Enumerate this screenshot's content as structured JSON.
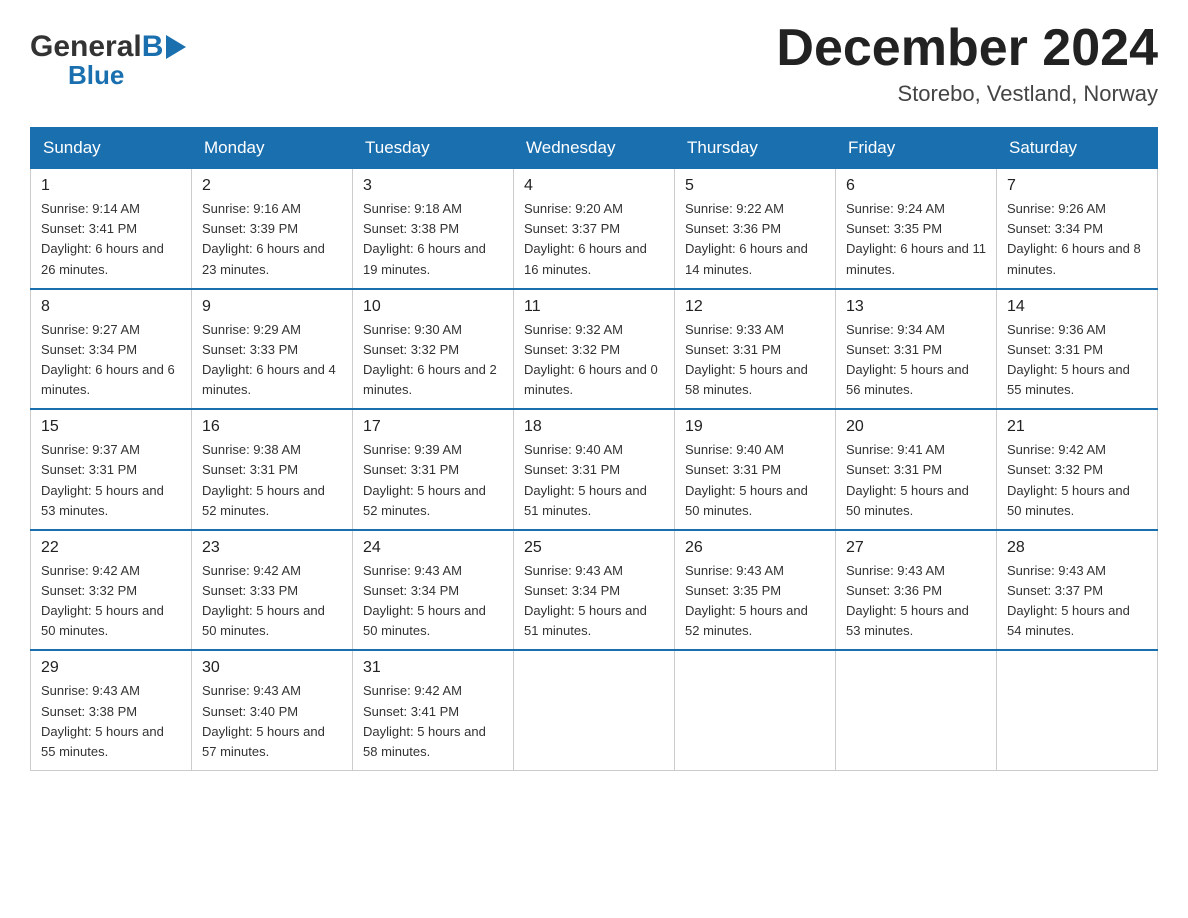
{
  "header": {
    "logo_general": "General",
    "logo_blue": "Blue",
    "month_title": "December 2024",
    "location": "Storebo, Vestland, Norway"
  },
  "days_of_week": [
    "Sunday",
    "Monday",
    "Tuesday",
    "Wednesday",
    "Thursday",
    "Friday",
    "Saturday"
  ],
  "weeks": [
    [
      {
        "day": "1",
        "sunrise": "Sunrise: 9:14 AM",
        "sunset": "Sunset: 3:41 PM",
        "daylight": "Daylight: 6 hours and 26 minutes."
      },
      {
        "day": "2",
        "sunrise": "Sunrise: 9:16 AM",
        "sunset": "Sunset: 3:39 PM",
        "daylight": "Daylight: 6 hours and 23 minutes."
      },
      {
        "day": "3",
        "sunrise": "Sunrise: 9:18 AM",
        "sunset": "Sunset: 3:38 PM",
        "daylight": "Daylight: 6 hours and 19 minutes."
      },
      {
        "day": "4",
        "sunrise": "Sunrise: 9:20 AM",
        "sunset": "Sunset: 3:37 PM",
        "daylight": "Daylight: 6 hours and 16 minutes."
      },
      {
        "day": "5",
        "sunrise": "Sunrise: 9:22 AM",
        "sunset": "Sunset: 3:36 PM",
        "daylight": "Daylight: 6 hours and 14 minutes."
      },
      {
        "day": "6",
        "sunrise": "Sunrise: 9:24 AM",
        "sunset": "Sunset: 3:35 PM",
        "daylight": "Daylight: 6 hours and 11 minutes."
      },
      {
        "day": "7",
        "sunrise": "Sunrise: 9:26 AM",
        "sunset": "Sunset: 3:34 PM",
        "daylight": "Daylight: 6 hours and 8 minutes."
      }
    ],
    [
      {
        "day": "8",
        "sunrise": "Sunrise: 9:27 AM",
        "sunset": "Sunset: 3:34 PM",
        "daylight": "Daylight: 6 hours and 6 minutes."
      },
      {
        "day": "9",
        "sunrise": "Sunrise: 9:29 AM",
        "sunset": "Sunset: 3:33 PM",
        "daylight": "Daylight: 6 hours and 4 minutes."
      },
      {
        "day": "10",
        "sunrise": "Sunrise: 9:30 AM",
        "sunset": "Sunset: 3:32 PM",
        "daylight": "Daylight: 6 hours and 2 minutes."
      },
      {
        "day": "11",
        "sunrise": "Sunrise: 9:32 AM",
        "sunset": "Sunset: 3:32 PM",
        "daylight": "Daylight: 6 hours and 0 minutes."
      },
      {
        "day": "12",
        "sunrise": "Sunrise: 9:33 AM",
        "sunset": "Sunset: 3:31 PM",
        "daylight": "Daylight: 5 hours and 58 minutes."
      },
      {
        "day": "13",
        "sunrise": "Sunrise: 9:34 AM",
        "sunset": "Sunset: 3:31 PM",
        "daylight": "Daylight: 5 hours and 56 minutes."
      },
      {
        "day": "14",
        "sunrise": "Sunrise: 9:36 AM",
        "sunset": "Sunset: 3:31 PM",
        "daylight": "Daylight: 5 hours and 55 minutes."
      }
    ],
    [
      {
        "day": "15",
        "sunrise": "Sunrise: 9:37 AM",
        "sunset": "Sunset: 3:31 PM",
        "daylight": "Daylight: 5 hours and 53 minutes."
      },
      {
        "day": "16",
        "sunrise": "Sunrise: 9:38 AM",
        "sunset": "Sunset: 3:31 PM",
        "daylight": "Daylight: 5 hours and 52 minutes."
      },
      {
        "day": "17",
        "sunrise": "Sunrise: 9:39 AM",
        "sunset": "Sunset: 3:31 PM",
        "daylight": "Daylight: 5 hours and 52 minutes."
      },
      {
        "day": "18",
        "sunrise": "Sunrise: 9:40 AM",
        "sunset": "Sunset: 3:31 PM",
        "daylight": "Daylight: 5 hours and 51 minutes."
      },
      {
        "day": "19",
        "sunrise": "Sunrise: 9:40 AM",
        "sunset": "Sunset: 3:31 PM",
        "daylight": "Daylight: 5 hours and 50 minutes."
      },
      {
        "day": "20",
        "sunrise": "Sunrise: 9:41 AM",
        "sunset": "Sunset: 3:31 PM",
        "daylight": "Daylight: 5 hours and 50 minutes."
      },
      {
        "day": "21",
        "sunrise": "Sunrise: 9:42 AM",
        "sunset": "Sunset: 3:32 PM",
        "daylight": "Daylight: 5 hours and 50 minutes."
      }
    ],
    [
      {
        "day": "22",
        "sunrise": "Sunrise: 9:42 AM",
        "sunset": "Sunset: 3:32 PM",
        "daylight": "Daylight: 5 hours and 50 minutes."
      },
      {
        "day": "23",
        "sunrise": "Sunrise: 9:42 AM",
        "sunset": "Sunset: 3:33 PM",
        "daylight": "Daylight: 5 hours and 50 minutes."
      },
      {
        "day": "24",
        "sunrise": "Sunrise: 9:43 AM",
        "sunset": "Sunset: 3:34 PM",
        "daylight": "Daylight: 5 hours and 50 minutes."
      },
      {
        "day": "25",
        "sunrise": "Sunrise: 9:43 AM",
        "sunset": "Sunset: 3:34 PM",
        "daylight": "Daylight: 5 hours and 51 minutes."
      },
      {
        "day": "26",
        "sunrise": "Sunrise: 9:43 AM",
        "sunset": "Sunset: 3:35 PM",
        "daylight": "Daylight: 5 hours and 52 minutes."
      },
      {
        "day": "27",
        "sunrise": "Sunrise: 9:43 AM",
        "sunset": "Sunset: 3:36 PM",
        "daylight": "Daylight: 5 hours and 53 minutes."
      },
      {
        "day": "28",
        "sunrise": "Sunrise: 9:43 AM",
        "sunset": "Sunset: 3:37 PM",
        "daylight": "Daylight: 5 hours and 54 minutes."
      }
    ],
    [
      {
        "day": "29",
        "sunrise": "Sunrise: 9:43 AM",
        "sunset": "Sunset: 3:38 PM",
        "daylight": "Daylight: 5 hours and 55 minutes."
      },
      {
        "day": "30",
        "sunrise": "Sunrise: 9:43 AM",
        "sunset": "Sunset: 3:40 PM",
        "daylight": "Daylight: 5 hours and 57 minutes."
      },
      {
        "day": "31",
        "sunrise": "Sunrise: 9:42 AM",
        "sunset": "Sunset: 3:41 PM",
        "daylight": "Daylight: 5 hours and 58 minutes."
      },
      null,
      null,
      null,
      null
    ]
  ]
}
